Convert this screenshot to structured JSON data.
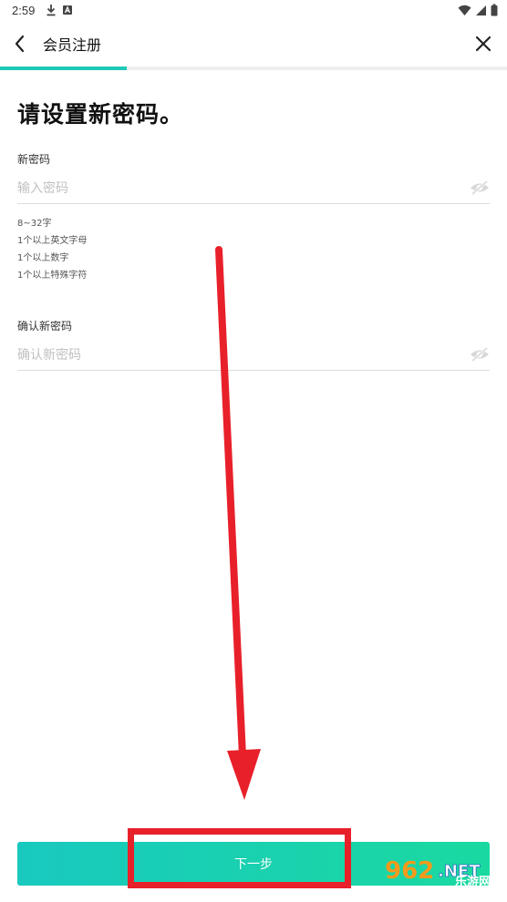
{
  "status_bar": {
    "time": "2:59",
    "left_icons": [
      "download-icon",
      "a-icon"
    ],
    "right_icons": [
      "wifi-icon",
      "signal-icon",
      "battery-icon"
    ]
  },
  "app_bar": {
    "title": "会员注册",
    "back_icon": "chevron-left-icon",
    "close_icon": "close-icon"
  },
  "progress": {
    "fraction": 0.25,
    "color": "#1fc9b7"
  },
  "heading": "请设置新密码。",
  "new_password": {
    "label": "新密码",
    "placeholder": "输入密码",
    "value": "",
    "icon": "eye-hidden-icon"
  },
  "rules": [
    "8~32字",
    "1个以上英文字母",
    "1个以上数字",
    "1个以上特殊字符"
  ],
  "confirm_password": {
    "label": "确认新密码",
    "placeholder": "确认新密码",
    "value": "",
    "icon": "eye-hidden-icon"
  },
  "next_button": {
    "label": "下一步"
  },
  "watermark": {
    "text": "962.NET",
    "subtext": "乐游网"
  },
  "colors": {
    "accent": "#1fc9b7",
    "annotation": "#e8202a"
  }
}
